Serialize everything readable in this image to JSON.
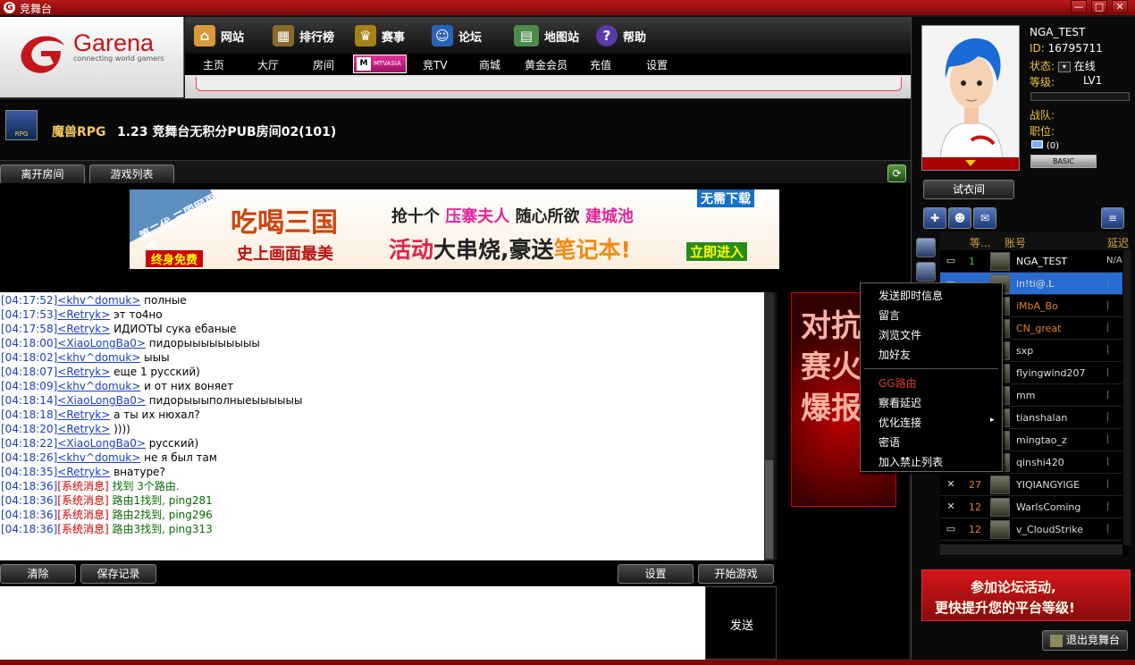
{
  "window": {
    "title": "竞舞台",
    "minimize": "—",
    "maximize": "□",
    "close": "✕"
  },
  "logo": {
    "brand": "Garena",
    "tagline": "connecting world gamers"
  },
  "nav_top": [
    {
      "label": "网站",
      "icon": "house-icon"
    },
    {
      "label": "排行榜",
      "icon": "ladder-icon"
    },
    {
      "label": "赛事",
      "icon": "trophy-icon"
    },
    {
      "label": "论坛",
      "icon": "person-icon"
    },
    {
      "label": "地图站",
      "icon": "map-icon"
    },
    {
      "label": "帮助",
      "icon": "help-icon"
    }
  ],
  "nav_sub": [
    "主页",
    "大厅",
    "房间",
    "竞TV",
    "商城",
    "黄金会员",
    "充值",
    "设置"
  ],
  "mtv_label": "MTVASIA",
  "room": {
    "game": "魔兽RPG",
    "name": "1.23 竞舞台无积分PUB房间02(101)",
    "game_icon_text": "RPG"
  },
  "room_buttons": {
    "leave": "离开房间",
    "game_list": "游戏列表"
  },
  "banner": {
    "corner": "第二代 三国网页游戏",
    "logo": "吃喝三国",
    "line1a": "抢十个",
    "line1b": "压寨夫人",
    "line1c": "随心所欲",
    "line1d": "建城池",
    "line2a": "活动",
    "line2b": "大串烧,豪送",
    "line2c": "笔记本!",
    "sub": "史上画面最美",
    "free": "终身免费",
    "nodl": "无需下载",
    "enter": "立即进入"
  },
  "chat": [
    {
      "time": "[04:17:52]",
      "user": "<khv^domuk>",
      "msg": "полные"
    },
    {
      "time": "[04:17:53]",
      "user": "<Retryk>",
      "msg": "эт то4но"
    },
    {
      "time": "[04:17:58]",
      "user": "<Retryk>",
      "msg": "ИДИОТЫ сука ебаные"
    },
    {
      "time": "[04:18:00]",
      "user": "<XiaoLongBa0>",
      "msg": "пидорыыыыыыыыы"
    },
    {
      "time": "[04:18:02]",
      "user": "<khv^domuk>",
      "msg": "ыыы"
    },
    {
      "time": "[04:18:07]",
      "user": "<Retryk>",
      "msg": "еще 1 русский)"
    },
    {
      "time": "[04:18:09]",
      "user": "<khv^domuk>",
      "msg": "и от них воняет"
    },
    {
      "time": "[04:18:14]",
      "user": "<XiaoLongBa0>",
      "msg": "пидорыыыполныеыыыыыы"
    },
    {
      "time": "[04:18:18]",
      "user": "<Retryk>",
      "msg": "а ты их нюхал?"
    },
    {
      "time": "[04:18:20]",
      "user": "<Retryk>",
      "msg": "))))"
    },
    {
      "time": "[04:18:22]",
      "user": "<XiaoLongBa0>",
      "msg": "русский)"
    },
    {
      "time": "[04:18:26]",
      "user": "<khv^domuk>",
      "msg": "не я был там"
    },
    {
      "time": "[04:18:35]",
      "user": "<Retryk>",
      "msg": "внатуре?"
    }
  ],
  "system_msgs": [
    {
      "time": "[04:18:36]",
      "tag": "[系统消息]",
      "msg": "找到 3个路由."
    },
    {
      "time": "[04:18:36]",
      "tag": "[系统消息]",
      "msg": "路由1找到, ping281"
    },
    {
      "time": "[04:18:36]",
      "tag": "[系统消息]",
      "msg": "路由2找到, ping296"
    },
    {
      "time": "[04:18:36]",
      "tag": "[系统消息]",
      "msg": "路由3找到, ping313"
    }
  ],
  "bottom_buttons": {
    "clear": "清除",
    "save": "保存记录",
    "settings": "设置",
    "start": "开始游戏",
    "send": "发送"
  },
  "profile": {
    "name": "NGA_TEST",
    "id_label": "ID:",
    "id": "16795711",
    "status_label": "状态:",
    "status": "在线",
    "level_label": "等级:",
    "level": "LV1",
    "clan_label": "战队:",
    "position_label": "职位:",
    "mail_count": "(0)",
    "badge": "BASIC",
    "try_on": "试衣间"
  },
  "user_list": {
    "hdr_level": "等...",
    "hdr_account": "账号",
    "hdr_delay": "延迟",
    "users": [
      {
        "level": "1",
        "name": "NGA_TEST",
        "ping": "N/A",
        "icon": "chat-icon"
      },
      {
        "level": "",
        "name": "in!ti@.L",
        "ping": "|",
        "icon": "chat-icon"
      },
      {
        "level": "",
        "name": "iMbA_Bo",
        "ping": "|",
        "icon": "swords-icon"
      },
      {
        "level": "",
        "name": "CN_great",
        "ping": "|",
        "icon": "swords-icon"
      },
      {
        "level": "",
        "name": "sxp",
        "ping": "|",
        "icon": "swords-icon"
      },
      {
        "level": "",
        "name": "flyingwind207",
        "ping": "|",
        "icon": "swords-icon"
      },
      {
        "level": "",
        "name": "mm",
        "ping": "|",
        "icon": "swords-icon"
      },
      {
        "level": "",
        "name": "tianshalan",
        "ping": "|",
        "icon": "swords-icon"
      },
      {
        "level": "",
        "name": "mingtao_z",
        "ping": "|",
        "icon": "swords-icon"
      },
      {
        "level": "",
        "name": "qinshi420",
        "ping": "|",
        "icon": "swords-icon"
      },
      {
        "level": "27",
        "name": "YIQIANGYIGE",
        "ping": "|",
        "icon": "swords-icon"
      },
      {
        "level": "12",
        "name": "WarlsComing",
        "ping": "|",
        "icon": "swords-icon"
      },
      {
        "level": "12",
        "name": "v_CloudStrike",
        "ping": "|",
        "icon": "chat-icon"
      }
    ]
  },
  "context_menu": [
    "发送即时信息",
    "留言",
    "浏览文件",
    "加好友",
    "GG路由",
    "察看延迟",
    "优化连接",
    "密语",
    "加入禁止列表"
  ],
  "mid_ad": "对抗赛火爆报",
  "promo": {
    "line1": "参加论坛活动,",
    "line2": "更快提升您的平台等级!"
  },
  "exit_label": "退出竞舞台"
}
